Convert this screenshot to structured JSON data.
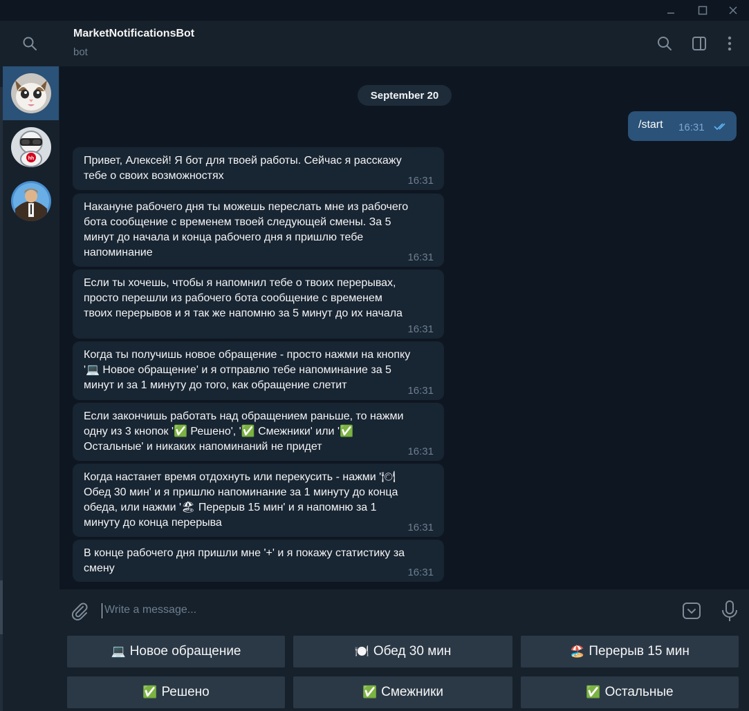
{
  "window": {
    "controls": [
      "minimize",
      "maximize",
      "close"
    ]
  },
  "sidebar": {
    "chats": [
      {
        "name": "cat-avatar",
        "active": true
      },
      {
        "name": "hh-robot-avatar",
        "active": false
      },
      {
        "name": "man-avatar",
        "active": false
      }
    ]
  },
  "header": {
    "title": "MarketNotificationsBot",
    "subtitle": "bot"
  },
  "chat": {
    "date": "September 20",
    "outgoing": {
      "text": "/start",
      "time": "16:31"
    },
    "messages": [
      {
        "text": "Привет, Алексей! Я бот для твоей работы. Сейчас я расскажу\nтебе о своих возможностях",
        "time": "16:31"
      },
      {
        "text": "Накануне рабочего дня ты можешь переслать мне из рабочего\nбота сообщение с временем твоей следующей смены. За 5\nминут до начала и конца рабочего дня я пришлю тебе\nнапоминание",
        "time": "16:31"
      },
      {
        "text": "Если ты хочешь, чтобы я напомнил тебе о твоих перерывах,\nпросто перешли из рабочего бота сообщение с временем\nтвоих перерывов и я так же напомню за 5 минут до их начала",
        "time": "16:31"
      },
      {
        "text": "Когда ты получишь новое обращение - просто нажми на кнопку\n'💻 Новое обращение' и я отправлю тебе напоминание за 5\nминут и за 1 минуту до того, как обращение слетит",
        "time": "16:31"
      },
      {
        "text": "Если закончишь работать над обращением раньше, то нажми\nодну из 3 кнопок '✅ Решено', '✅ Смежники' или '✅\nОстальные'  и никаких напоминаний не придет",
        "time": "16:31"
      },
      {
        "text": "Когда настанет время отдохнуть или перекусить - нажми '🍽\nОбед 30 мин' и я пришлю напоминание за 1 минуту до конца\nобеда, или нажми '🏖 Перерыв 15 мин' и я  напомню за 1\nминуту до конца перерыва",
        "time": "16:31"
      },
      {
        "text": "В конце рабочего дня пришли мне '+' и я покажу статистику за\nсмену",
        "time": "16:31"
      }
    ]
  },
  "composer": {
    "placeholder": "Write a message..."
  },
  "keyboard": {
    "rows": [
      [
        {
          "emoji": "💻",
          "label": "Новое обращение"
        },
        {
          "emoji": "🍽️",
          "label": "Обед 30 мин"
        },
        {
          "emoji": "🏖️",
          "label": "Перерыв 15 мин"
        }
      ],
      [
        {
          "emoji": "✅",
          "label": "Решено"
        },
        {
          "emoji": "✅",
          "label": "Смежники"
        },
        {
          "emoji": "✅",
          "label": "Остальные"
        }
      ]
    ]
  },
  "colors": {
    "background": "#0e1621",
    "panel": "#17212b",
    "incoming_bubble": "#182533",
    "outgoing_bubble": "#2b5278",
    "keyboard_button": "#2b3947",
    "muted_text": "#6d7f8f"
  }
}
